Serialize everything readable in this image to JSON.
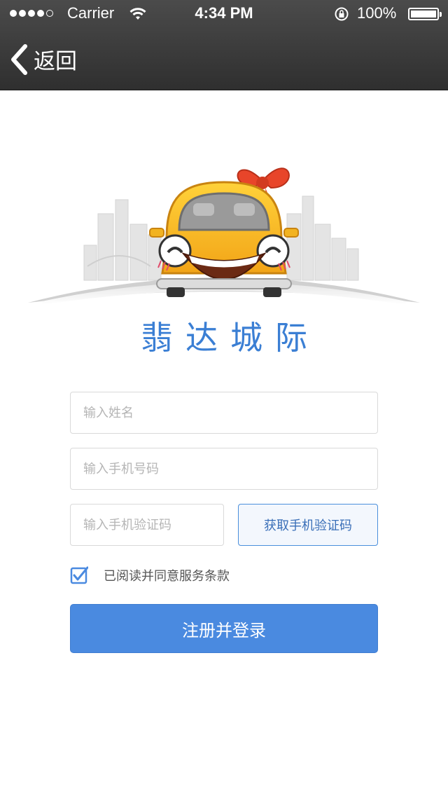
{
  "status_bar": {
    "carrier": "Carrier",
    "time": "4:34 PM",
    "battery": "100%"
  },
  "nav": {
    "back_label": "返回"
  },
  "brand": {
    "name": "翡达城际"
  },
  "form": {
    "name_placeholder": "输入姓名",
    "phone_placeholder": "输入手机号码",
    "code_placeholder": "输入手机验证码",
    "get_code_label": "获取手机验证码",
    "agree_label": "已阅读并同意服务条款",
    "agree_checked": true,
    "submit_label": "注册并登录"
  },
  "colors": {
    "accent": "#4a8ae0",
    "brand_text": "#3b7fd4",
    "topbar": "#3a3a3a"
  }
}
